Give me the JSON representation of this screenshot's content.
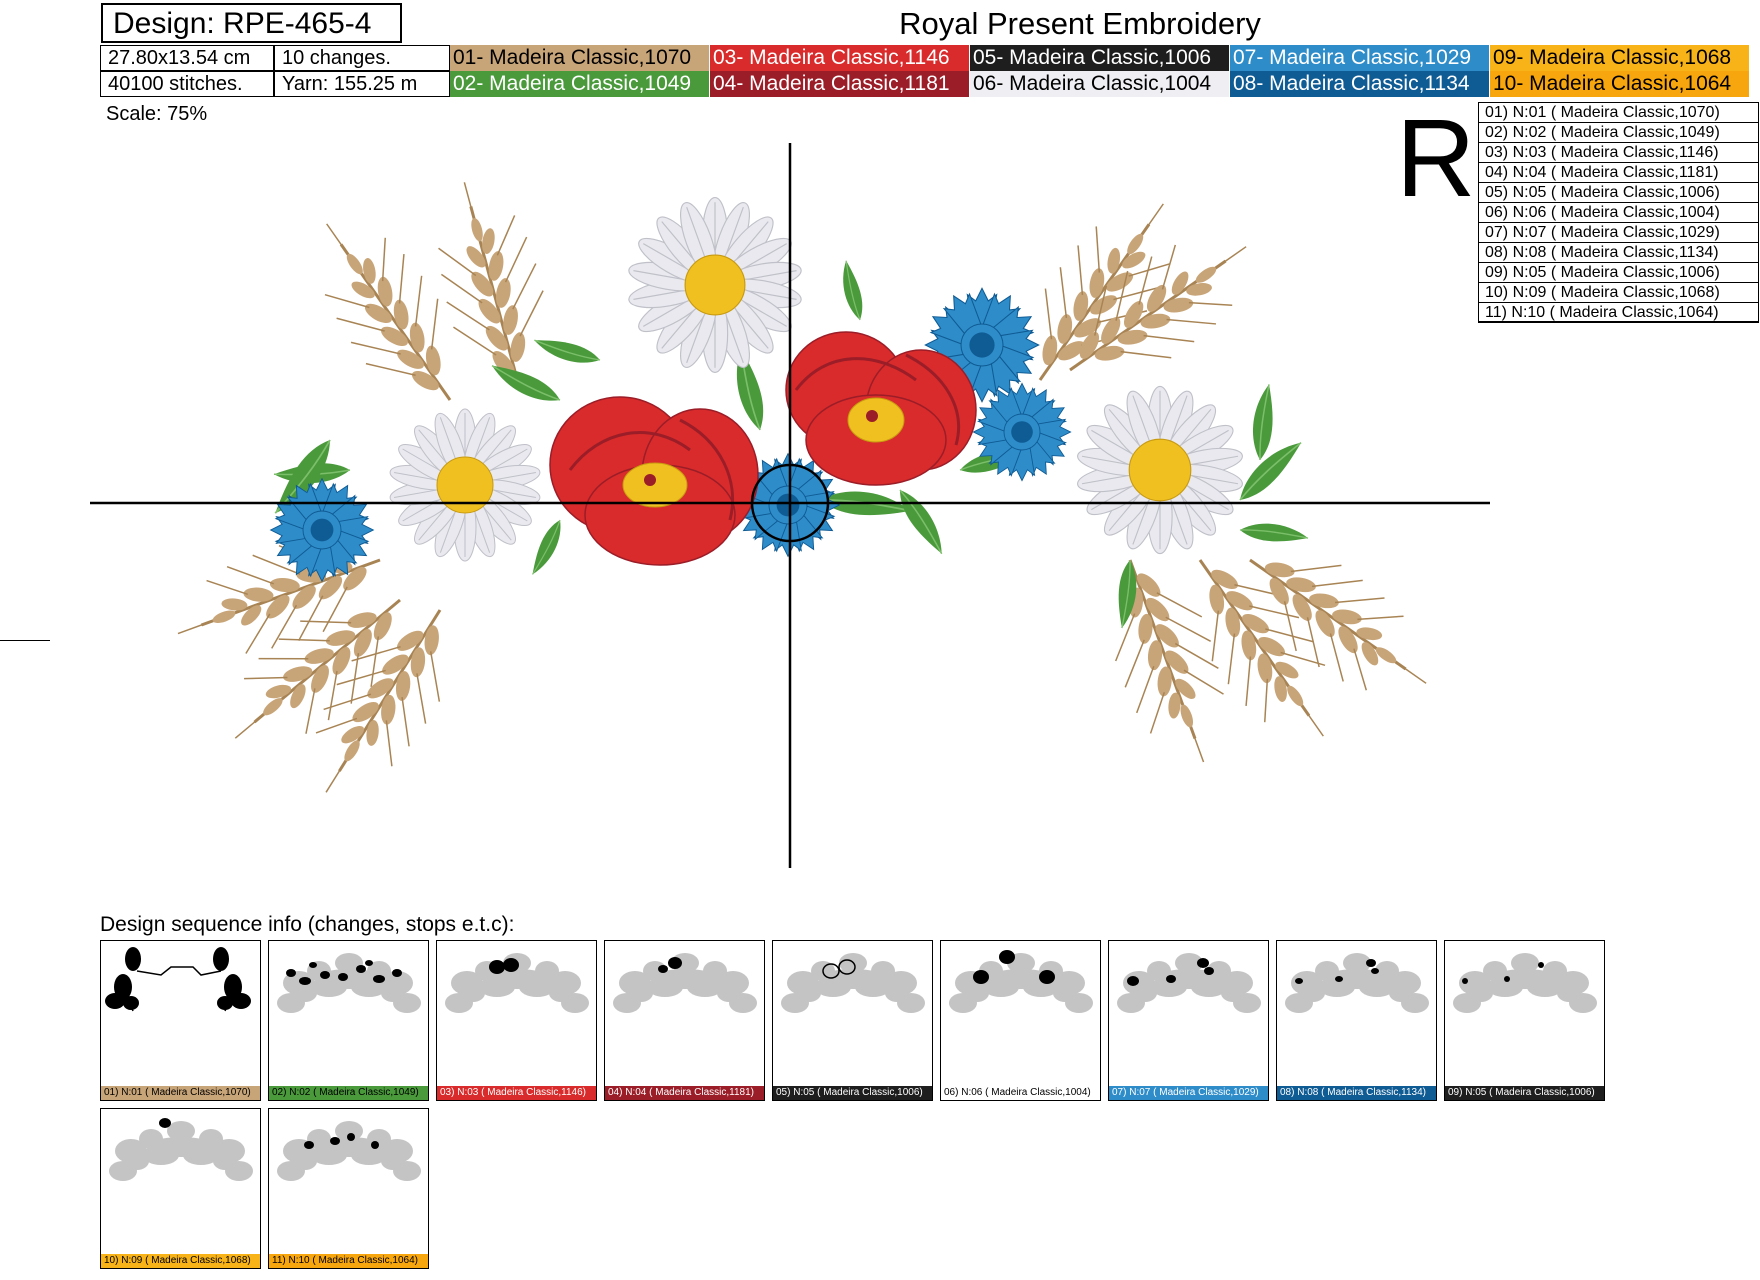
{
  "header": {
    "design_label": "Design: RPE-465-4",
    "brand_title": "Royal Present Embroidery"
  },
  "info": {
    "size": "27.80x13.54 cm",
    "changes": "10 changes.",
    "stitches": "40100 stitches.",
    "yarn": "Yarn: 155.25 m"
  },
  "threads": [
    {
      "label": "01- Madeira Classic,1070",
      "bg": "#c8a578",
      "fg": "#000000"
    },
    {
      "label": "03- Madeira Classic,1146",
      "bg": "#d92b2b",
      "fg": "#ffffff"
    },
    {
      "label": "05- Madeira Classic,1006",
      "bg": "#1e1e1e",
      "fg": "#ffffff"
    },
    {
      "label": "07- Madeira Classic,1029",
      "bg": "#2e8cc9",
      "fg": "#ffffff"
    },
    {
      "label": "09- Madeira Classic,1068",
      "bg": "#f7b318",
      "fg": "#000000"
    },
    {
      "label": "02- Madeira Classic,1049",
      "bg": "#4a9a3c",
      "fg": "#ffffff"
    },
    {
      "label": "04- Madeira Classic,1181",
      "bg": "#9b1d28",
      "fg": "#ffffff"
    },
    {
      "label": "06- Madeira Classic,1004",
      "bg": "#eeeef3",
      "fg": "#000000"
    },
    {
      "label": "08- Madeira Classic,1134",
      "bg": "#0f5b94",
      "fg": "#ffffff"
    },
    {
      "label": "10- Madeira Classic,1064",
      "bg": "#f8a60e",
      "fg": "#000000"
    }
  ],
  "scale_label": "Scale: 75%",
  "orientation_letter": "R",
  "needle_list": [
    "01) N:01 ( Madeira Classic,1070)",
    "02) N:02 ( Madeira Classic,1049)",
    "03) N:03 ( Madeira Classic,1146)",
    "04) N:04 ( Madeira Classic,1181)",
    "05) N:05 ( Madeira Classic,1006)",
    "06) N:06 ( Madeira Classic,1004)",
    "07) N:07 ( Madeira Classic,1029)",
    "08) N:08 ( Madeira Classic,1134)",
    "09) N:05 ( Madeira Classic,1006)",
    "10) N:09 ( Madeira Classic,1068)",
    "11) N:10 ( Madeira Classic,1064)"
  ],
  "colors": {
    "wheat": "#c8a578",
    "wheat_dark": "#a88454",
    "leaf": "#4a9a3c",
    "leaf_light": "#7cbf6a",
    "poppy": "#d92b2b",
    "poppy_dark": "#9b1d28",
    "daisy": "#e9e9ef",
    "daisy_shade": "#bfc0c8",
    "cornflower": "#2e8cc9",
    "cornflower_dark": "#0f5b94",
    "center_yellow": "#f0c020",
    "gray_thumb": "#c4c4c4"
  },
  "sequence": {
    "title": "Design sequence info (changes, stops e.t.c):",
    "steps": [
      {
        "label": "01) N:01 ( Madeira Classic,1070)",
        "bg": "#c8a578",
        "fg": "#000000",
        "highlight": "wheat"
      },
      {
        "label": "02) N:02 ( Madeira Classic,1049)",
        "bg": "#4a9a3c",
        "fg": "#000000",
        "highlight": "leaves"
      },
      {
        "label": "03) N:03 ( Madeira Classic,1146)",
        "bg": "#d92b2b",
        "fg": "#ffffff",
        "highlight": "poppies"
      },
      {
        "label": "04) N:04 ( Madeira Classic,1181)",
        "bg": "#9b1d28",
        "fg": "#ffffff",
        "highlight": "poppy-detail"
      },
      {
        "label": "05) N:05 ( Madeira Classic,1006)",
        "bg": "#1e1e1e",
        "fg": "#ffffff",
        "highlight": "poppy-outline"
      },
      {
        "label": "06) N:06 ( Madeira Classic,1004)",
        "bg": "#ffffff",
        "fg": "#000000",
        "highlight": "daisies"
      },
      {
        "label": "07) N:07 ( Madeira Classic,1029)",
        "bg": "#2e8cc9",
        "fg": "#ffffff",
        "highlight": "cornflowers"
      },
      {
        "label": "08) N:08 ( Madeira Classic,1134)",
        "bg": "#0f5b94",
        "fg": "#ffffff",
        "highlight": "cornflower-detail"
      },
      {
        "label": "09) N:05 ( Madeira Classic,1006)",
        "bg": "#1e1e1e",
        "fg": "#ffffff",
        "highlight": "small-dots"
      },
      {
        "label": "10) N:09 ( Madeira Classic,1068)",
        "bg": "#f7b318",
        "fg": "#000000",
        "highlight": "top-center"
      },
      {
        "label": "11) N:10 ( Madeira Classic,1064)",
        "bg": "#f8a60e",
        "fg": "#000000",
        "highlight": "centers"
      }
    ]
  }
}
